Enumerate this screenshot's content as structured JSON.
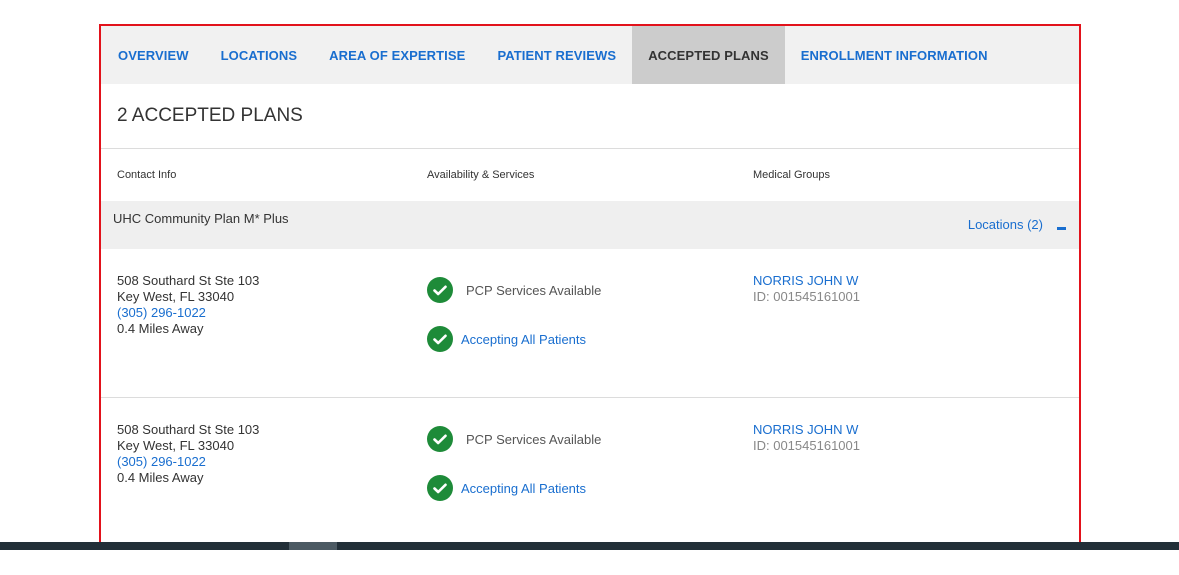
{
  "tabs": [
    {
      "label": "OVERVIEW"
    },
    {
      "label": "LOCATIONS"
    },
    {
      "label": "AREA OF EXPERTISE"
    },
    {
      "label": "PATIENT REVIEWS"
    },
    {
      "label": "ACCEPTED PLANS",
      "active": true
    },
    {
      "label": "ENROLLMENT INFORMATION"
    }
  ],
  "heading": "2 ACCEPTED PLANS",
  "columns": {
    "contact": "Contact Info",
    "availability": "Availability & Services",
    "groups": "Medical Groups"
  },
  "plan": {
    "name": "UHC Community Plan M* Plus",
    "locations_label": "Locations (2)"
  },
  "rows": [
    {
      "address1": "508 Southard St Ste 103",
      "address2": "Key West, FL 33040",
      "phone": "(305) 296-1022",
      "distance": "0.4 Miles Away",
      "service1": "PCP Services Available",
      "service2": "Accepting All Patients",
      "group_name": "NORRIS JOHN W",
      "group_id": "ID: 001545161001"
    },
    {
      "address1": "508 Southard St Ste 103",
      "address2": "Key West, FL 33040",
      "phone": "(305) 296-1022",
      "distance": "0.4 Miles Away",
      "service1": "PCP Services Available",
      "service2": "Accepting All Patients",
      "group_name": "NORRIS JOHN W",
      "group_id": "ID: 001545161001"
    }
  ],
  "colors": {
    "link": "#196ecf",
    "check": "#1e8b39",
    "highlight_border": "#e2121b",
    "active_tab_bg": "#cccccc"
  }
}
